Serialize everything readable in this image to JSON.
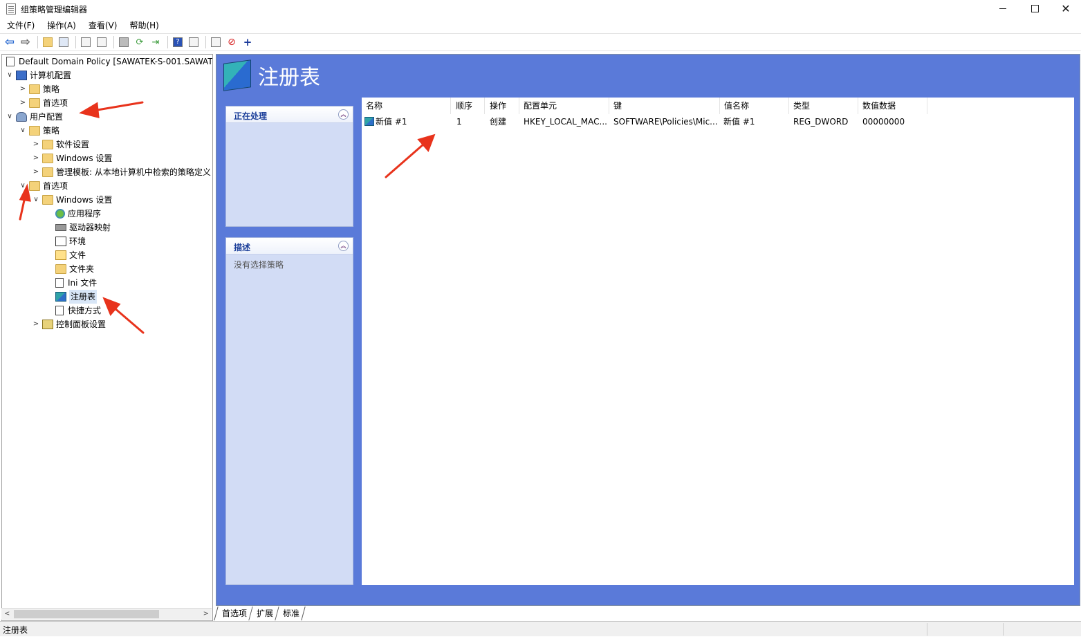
{
  "window": {
    "title": "组策略管理编辑器"
  },
  "menu": [
    "文件(F)",
    "操作(A)",
    "查看(V)",
    "帮助(H)"
  ],
  "toolbar": [
    {
      "name": "back-icon"
    },
    {
      "name": "forward-icon"
    },
    {
      "name": "up-folder-icon"
    },
    {
      "name": "show-hide-tree-icon"
    },
    {
      "name": "copy-icon"
    },
    {
      "name": "paste-icon"
    },
    {
      "name": "print-icon"
    },
    {
      "name": "refresh-icon"
    },
    {
      "name": "export-icon"
    },
    {
      "name": "help-icon"
    },
    {
      "name": "properties-icon"
    },
    {
      "name": "new-document-icon"
    },
    {
      "name": "stop-icon"
    },
    {
      "name": "add-icon"
    }
  ],
  "tree": {
    "root": "Default Domain Policy [SAWATEK-S-001.SAWATEK",
    "items": [
      {
        "label": "计算机配置",
        "icon": "computer-icon",
        "expander": "∨"
      },
      {
        "label": "策略",
        "icon": "folder-icon",
        "expander": ">"
      },
      {
        "label": "首选项",
        "icon": "folder-icon",
        "expander": ">"
      },
      {
        "label": "用户配置",
        "icon": "user-icon",
        "expander": "∨"
      },
      {
        "label": "策略",
        "icon": "folder-icon",
        "expander": "∨"
      },
      {
        "label": "软件设置",
        "icon": "folder-icon",
        "expander": ">"
      },
      {
        "label": "Windows 设置",
        "icon": "folder-icon",
        "expander": ">"
      },
      {
        "label": "管理模板: 从本地计算机中检索的策略定义",
        "icon": "folder-icon",
        "expander": ">"
      },
      {
        "label": "首选项",
        "icon": "folder-icon",
        "expander": "∨"
      },
      {
        "label": "Windows 设置",
        "icon": "folder-icon",
        "expander": "∨"
      },
      {
        "label": "应用程序",
        "icon": "application-icon",
        "expander": ""
      },
      {
        "label": "驱动器映射",
        "icon": "drive-icon",
        "expander": ""
      },
      {
        "label": "环境",
        "icon": "environment-icon",
        "expander": ""
      },
      {
        "label": "文件",
        "icon": "file-icon",
        "expander": ""
      },
      {
        "label": "文件夹",
        "icon": "folder-icon",
        "expander": ""
      },
      {
        "label": "Ini 文件",
        "icon": "ini-file-icon",
        "expander": ""
      },
      {
        "label": "注册表",
        "icon": "registry-icon",
        "expander": ""
      },
      {
        "label": "快捷方式",
        "icon": "shortcut-icon",
        "expander": ""
      },
      {
        "label": "控制面板设置",
        "icon": "control-panel-icon",
        "expander": ">"
      }
    ]
  },
  "right": {
    "title": "注册表",
    "processing_label": "正在处理",
    "description_label": "描述",
    "description_text": "没有选择策略",
    "columns": [
      "名称",
      "顺序",
      "操作",
      "配置单元",
      "键",
      "值名称",
      "类型",
      "数值数据"
    ],
    "rows": [
      [
        "新值 #1",
        "1",
        "创建",
        "HKEY_LOCAL_MAC...",
        "SOFTWARE\\Policies\\Mic...",
        "新值 #1",
        "REG_DWORD",
        "00000000"
      ]
    ]
  },
  "tabs": [
    "首选项",
    "扩展",
    "标准"
  ],
  "status": "注册表",
  "colors": {
    "accent": "#5a7ad9",
    "annotation": "#e8331c"
  }
}
